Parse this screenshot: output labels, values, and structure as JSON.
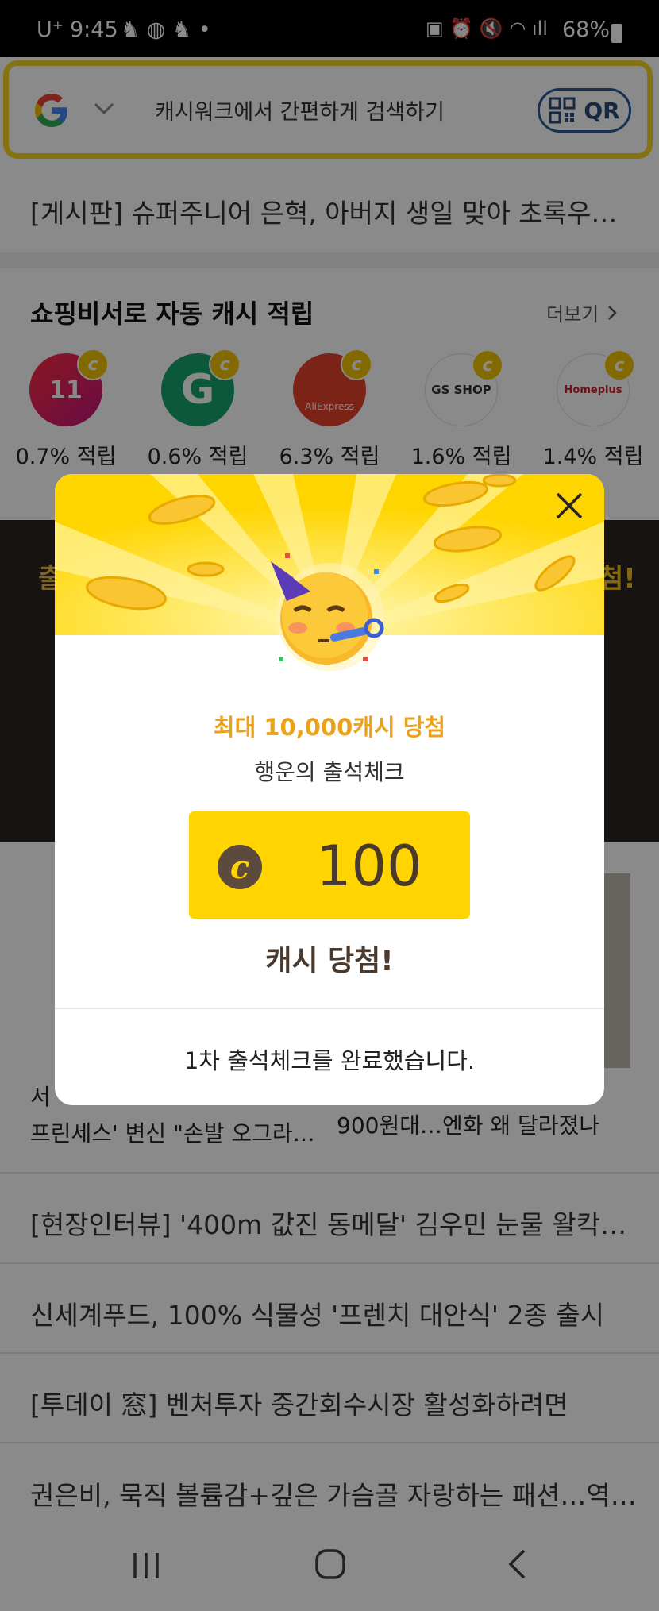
{
  "status": {
    "carrier": "U⁺",
    "time": "9:45",
    "battery": "68%"
  },
  "search": {
    "placeholder": "캐시워크에서 간편하게 검색하기",
    "qr_label": "QR"
  },
  "ticker": "[게시판] 슈퍼주니어 은혁, 아버지 생일 맞아 초록우…",
  "shopping": {
    "title": "쇼핑비서로 자동 캐시 적립",
    "more": "더보기",
    "stores": [
      {
        "name": "11번가",
        "logo": "11",
        "rate": "0.7% 적립",
        "color": "#e0205a"
      },
      {
        "name": "G마켓",
        "logo": "G",
        "rate": "0.6% 적립",
        "color": "#16a56b"
      },
      {
        "name": "AliExpress",
        "logo": "AliExpress",
        "rate": "6.3% 적립",
        "color": "#e4412b"
      },
      {
        "name": "GS SHOP",
        "logo": "GS SHOP",
        "rate": "1.6% 적립",
        "color": "#ffffff"
      },
      {
        "name": "Homeplus",
        "logo": "Homeplus",
        "rate": "1.4% 적립",
        "color": "#ffffff"
      }
    ],
    "badge": "c"
  },
  "banner": {
    "left_char": "출",
    "right_char": "첨!"
  },
  "news_under_modal": {
    "left_line1": "서",
    "left_line2": "프린세스' 변신 \"손발 오그라…",
    "right_line2": "900원대…엔화 왜 달라졌나"
  },
  "news": [
    "[현장인터뷰] '400m 값진 동메달' 김우민 눈물 왈칵…",
    "신세계푸드, 100% 식물성 '프렌치 대안식' 2종 출시",
    "[투데이 窓] 벤처투자 중간회수시장 활성화하려면",
    "권은비, 묵직 볼륨감+깊은 가슴골 자랑하는 패션…역…"
  ],
  "modal": {
    "headline": "최대 10,000캐시 당첨",
    "subtitle": "행운의 출석체크",
    "amount": "100",
    "coin_symbol": "c",
    "result": "캐시 당첨!",
    "footer": "1차 출석체크를 완료했습니다.",
    "accent": "#ffd500",
    "headline_color": "#e9a21a"
  },
  "icons": [
    "google-logo",
    "chevron-down-icon",
    "qr-code-icon",
    "chevron-right-icon",
    "close-icon",
    "party-face-emoji",
    "coin-icon",
    "recents-icon",
    "home-icon",
    "back-icon"
  ]
}
